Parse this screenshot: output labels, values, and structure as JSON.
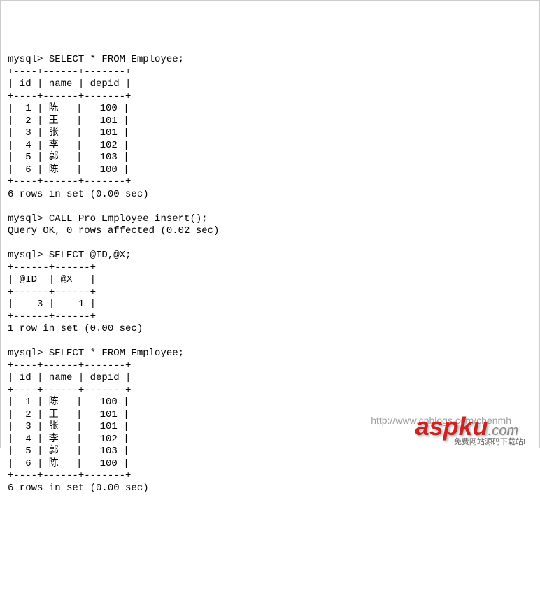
{
  "query1": {
    "prompt": "mysql> ",
    "sql": "SELECT * FROM Employee;",
    "sep_top": "+----+------+-------+",
    "header": "| id | name | depid |",
    "sep_mid": "+----+------+-------+",
    "rows": [
      "|  1 | 陈   |   100 |",
      "|  2 | 王   |   101 |",
      "|  3 | 张   |   101 |",
      "|  4 | 李   |   102 |",
      "|  5 | 郭   |   103 |",
      "|  6 | 陈   |   100 |"
    ],
    "sep_bot": "+----+------+-------+",
    "status": "6 rows in set (0.00 sec)"
  },
  "call": {
    "prompt": "mysql> ",
    "sql": "CALL Pro_Employee_insert();",
    "status": "Query OK, 0 rows affected (0.02 sec)"
  },
  "query2": {
    "prompt": "mysql> ",
    "sql": "SELECT @ID,@X;",
    "sep_top": "+------+------+",
    "header": "| @ID  | @X   |",
    "sep_mid": "+------+------+",
    "rows": [
      "|    3 |    1 |"
    ],
    "sep_bot": "+------+------+",
    "status": "1 row in set (0.00 sec)"
  },
  "query3": {
    "prompt": "mysql> ",
    "sql": "SELECT * FROM Employee;",
    "sep_top": "+----+------+-------+",
    "header": "| id | name | depid |",
    "sep_mid": "+----+------+-------+",
    "rows": [
      "|  1 | 陈   |   100 |",
      "|  2 | 王   |   101 |",
      "|  3 | 张   |   101 |",
      "|  4 | 李   |   102 |",
      "|  5 | 郭   |   103 |",
      "|  6 | 陈   |   100 |"
    ],
    "sep_bot": "+----+------+-------+",
    "status": "6 rows in set (0.00 sec)"
  },
  "watermark": {
    "url": "http://www.cnblogs.com/chenmh",
    "logo_main": "aspku",
    "logo_ext": ".com",
    "sub": "免费网站源码下载站!"
  }
}
